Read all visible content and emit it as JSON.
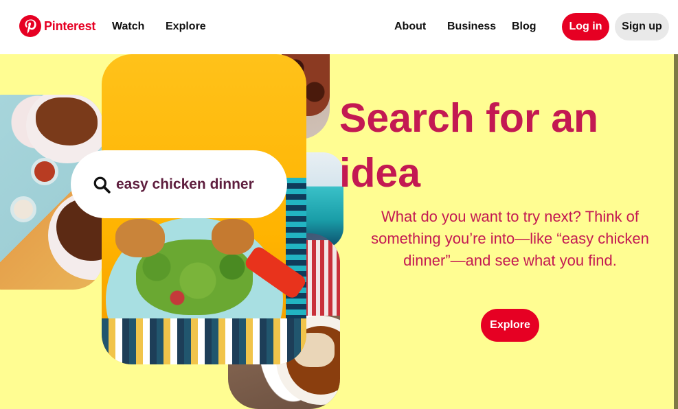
{
  "header": {
    "brand": "Pinterest",
    "nav_left": [
      "Watch",
      "Explore"
    ],
    "nav_right": [
      "About",
      "Business",
      "Blog"
    ],
    "login_label": "Log in",
    "signup_label": "Sign up"
  },
  "hero": {
    "search_query": "easy chicken dinner",
    "title": "Search for an idea",
    "description": "What do you want to try next? Think of something you’re into—like “easy chicken dinner”—and see what you find.",
    "explore_button": "Explore"
  },
  "colors": {
    "brand_red": "#e60023",
    "hero_text": "#c31952",
    "background": "#fffd92"
  },
  "icons": [
    "pinterest-logo-icon",
    "search-icon"
  ]
}
